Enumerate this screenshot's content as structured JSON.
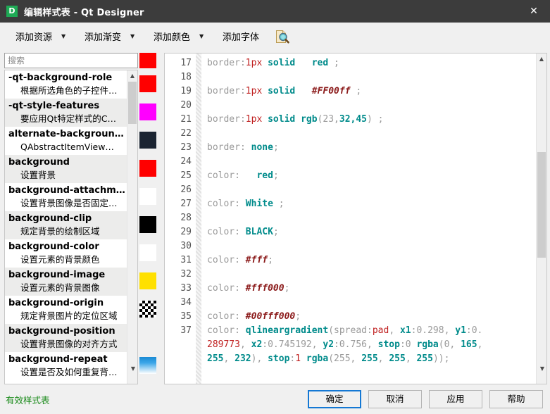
{
  "titlebar": {
    "icon": "designer-d-icon",
    "title": "编辑样式表 - Qt Designer",
    "close_label": "✕"
  },
  "toolbar": {
    "items": [
      {
        "label": "添加资源",
        "has_arrow": true
      },
      {
        "label": "添加渐变",
        "has_arrow": true
      },
      {
        "label": "添加颜色",
        "has_arrow": true
      },
      {
        "label": "添加字体",
        "has_arrow": false
      }
    ],
    "preview_icon": "document-magnifier-icon"
  },
  "search": {
    "placeholder": "搜索",
    "value": ""
  },
  "property_list": {
    "items": [
      {
        "name": "-qt-background-role",
        "desc": "根据所选角色的子控件…",
        "swatch": "#ff0000"
      },
      {
        "name": "-qt-style-features",
        "desc": "要应用Qt特定样式的C…",
        "swatch": "#ff00ff"
      },
      {
        "name": "alternate-backgroun…",
        "desc": "QAbstractItemView…",
        "swatch": "#1b2432"
      },
      {
        "name": "background",
        "desc": "设置背景",
        "swatch": "#ff0000"
      },
      {
        "name": "background-attachm…",
        "desc": "设置背景图像是否固定…",
        "swatch": "#ffffff"
      },
      {
        "name": "background-clip",
        "desc": "规定背景的绘制区域",
        "swatch": "#000000"
      },
      {
        "name": "background-color",
        "desc": "设置元素的背景颜色",
        "swatch": "#ffffff"
      },
      {
        "name": "background-image",
        "desc": "设置元素的背景图像",
        "swatch": "#ffe000"
      },
      {
        "name": "background-origin",
        "desc": "规定背景图片的定位区域",
        "swatch": "checker"
      },
      {
        "name": "background-position",
        "desc": "设置背景图像的对齐方式",
        "swatch": "none"
      },
      {
        "name": "background-repeat",
        "desc": "设置是否及如何重复背…",
        "swatch": "gradient"
      }
    ]
  },
  "editor": {
    "first_line_number": 17,
    "lines": [
      {
        "number": 17,
        "tokens": [
          {
            "t": "border:",
            "c": "prop"
          },
          {
            "t": "1px",
            "c": "num"
          },
          {
            "t": " ",
            "c": "plain"
          },
          {
            "t": "solid",
            "c": "kw"
          },
          {
            "t": "   ",
            "c": "plain"
          },
          {
            "t": "red",
            "c": "kw"
          },
          {
            "t": " ;",
            "c": "plain"
          }
        ]
      },
      {
        "number": 18,
        "tokens": []
      },
      {
        "number": 19,
        "tokens": [
          {
            "t": "border:",
            "c": "prop"
          },
          {
            "t": "1px",
            "c": "num"
          },
          {
            "t": " ",
            "c": "plain"
          },
          {
            "t": "solid",
            "c": "kw"
          },
          {
            "t": "   ",
            "c": "plain"
          },
          {
            "t": "#FF00ff",
            "c": "hex"
          },
          {
            "t": " ;",
            "c": "plain"
          }
        ]
      },
      {
        "number": 20,
        "tokens": []
      },
      {
        "number": 21,
        "tokens": [
          {
            "t": "border:",
            "c": "prop"
          },
          {
            "t": "1px",
            "c": "num"
          },
          {
            "t": " ",
            "c": "plain"
          },
          {
            "t": "solid",
            "c": "kw"
          },
          {
            "t": " ",
            "c": "plain"
          },
          {
            "t": "rgb",
            "c": "kw"
          },
          {
            "t": "(",
            "c": "plain"
          },
          {
            "t": "23",
            "c": "plain"
          },
          {
            "t": ",",
            "c": "plain"
          },
          {
            "t": "32,45",
            "c": "kw"
          },
          {
            "t": ") ;",
            "c": "plain"
          }
        ]
      },
      {
        "number": 22,
        "tokens": []
      },
      {
        "number": 23,
        "tokens": [
          {
            "t": "border: ",
            "c": "prop"
          },
          {
            "t": "none",
            "c": "kw"
          },
          {
            "t": ";",
            "c": "plain"
          }
        ]
      },
      {
        "number": 24,
        "tokens": []
      },
      {
        "number": 25,
        "tokens": [
          {
            "t": "color:   ",
            "c": "prop"
          },
          {
            "t": "red",
            "c": "kw"
          },
          {
            "t": ";",
            "c": "plain"
          }
        ]
      },
      {
        "number": 26,
        "tokens": []
      },
      {
        "number": 27,
        "tokens": [
          {
            "t": "color: ",
            "c": "prop"
          },
          {
            "t": "White",
            "c": "kw"
          },
          {
            "t": " ;",
            "c": "plain"
          }
        ]
      },
      {
        "number": 28,
        "tokens": []
      },
      {
        "number": 29,
        "tokens": [
          {
            "t": "color: ",
            "c": "prop"
          },
          {
            "t": "BLACK",
            "c": "kw"
          },
          {
            "t": ";",
            "c": "plain"
          }
        ]
      },
      {
        "number": 30,
        "tokens": []
      },
      {
        "number": 31,
        "tokens": [
          {
            "t": "color: ",
            "c": "prop"
          },
          {
            "t": "#fff",
            "c": "hex"
          },
          {
            "t": ";",
            "c": "plain"
          }
        ]
      },
      {
        "number": 32,
        "tokens": []
      },
      {
        "number": 33,
        "tokens": [
          {
            "t": "color: ",
            "c": "prop"
          },
          {
            "t": "#fff000",
            "c": "hex"
          },
          {
            "t": ";",
            "c": "plain"
          }
        ]
      },
      {
        "number": 34,
        "tokens": []
      },
      {
        "number": 35,
        "tokens": [
          {
            "t": "color: ",
            "c": "prop"
          },
          {
            "t": "#00fff000",
            "c": "hex"
          },
          {
            "t": ";",
            "c": "plain"
          }
        ]
      },
      {
        "number": 37,
        "tokens": [
          {
            "t": "color: ",
            "c": "prop"
          },
          {
            "t": "qlineargradient",
            "c": "kw"
          },
          {
            "t": "(spread:",
            "c": "plain"
          },
          {
            "t": "pad",
            "c": "num"
          },
          {
            "t": ", ",
            "c": "plain"
          },
          {
            "t": "x1",
            "c": "kw"
          },
          {
            "t": ":0.298, ",
            "c": "plain"
          },
          {
            "t": "y1",
            "c": "kw"
          },
          {
            "t": ":0.",
            "c": "plain"
          }
        ]
      },
      {
        "number": "",
        "tokens": [
          {
            "t": "289773",
            "c": "num"
          },
          {
            "t": ", ",
            "c": "plain"
          },
          {
            "t": "x2",
            "c": "kw"
          },
          {
            "t": ":0.745192, ",
            "c": "plain"
          },
          {
            "t": "y2",
            "c": "kw"
          },
          {
            "t": ":0.756, ",
            "c": "plain"
          },
          {
            "t": "stop",
            "c": "kw"
          },
          {
            "t": ":0 ",
            "c": "plain"
          },
          {
            "t": "rgba",
            "c": "kw"
          },
          {
            "t": "(0, ",
            "c": "plain"
          },
          {
            "t": "165",
            "c": "kw"
          },
          {
            "t": ", ",
            "c": "plain"
          }
        ]
      },
      {
        "number": "",
        "tokens": [
          {
            "t": "255",
            "c": "kw"
          },
          {
            "t": ", ",
            "c": "plain"
          },
          {
            "t": "232",
            "c": "kw"
          },
          {
            "t": "), ",
            "c": "plain"
          },
          {
            "t": "stop",
            "c": "kw"
          },
          {
            "t": ":",
            "c": "plain"
          },
          {
            "t": "1",
            "c": "num"
          },
          {
            "t": " ",
            "c": "plain"
          },
          {
            "t": "rgba",
            "c": "kw"
          },
          {
            "t": "(255, ",
            "c": "plain"
          },
          {
            "t": "255",
            "c": "kw"
          },
          {
            "t": ", ",
            "c": "plain"
          },
          {
            "t": "255",
            "c": "kw"
          },
          {
            "t": ", ",
            "c": "plain"
          },
          {
            "t": "255",
            "c": "kw"
          },
          {
            "t": "));",
            "c": "plain"
          }
        ]
      }
    ]
  },
  "footer": {
    "status": "有效样式表",
    "status_color": "#1a8a1a",
    "buttons": [
      {
        "label": "确定",
        "default": true
      },
      {
        "label": "取消",
        "default": false
      },
      {
        "label": "应用",
        "default": false
      },
      {
        "label": "帮助",
        "default": false
      }
    ]
  }
}
